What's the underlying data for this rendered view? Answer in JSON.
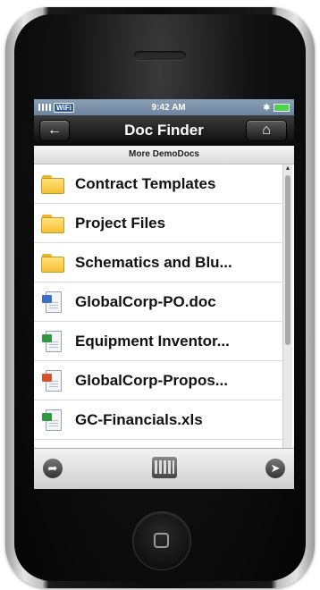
{
  "status_bar": {
    "time": "9:42 AM",
    "carrier_label": "WiFi",
    "bluetooth_glyph": "✱"
  },
  "nav": {
    "title": "Doc Finder",
    "back_icon": "back-arrow-icon",
    "home_icon": "home-icon"
  },
  "subheader": "More DemoDocs",
  "items": [
    {
      "label": "Contract Templates",
      "icon": "folder-icon",
      "type": "folder"
    },
    {
      "label": "Project Files",
      "icon": "folder-icon",
      "type": "folder"
    },
    {
      "label": "Schematics and Blu...",
      "icon": "folder-icon",
      "type": "folder"
    },
    {
      "label": "GlobalCorp-PO.doc",
      "icon": "word-doc-icon",
      "type": "doc",
      "badge_color": "#3b6fc9"
    },
    {
      "label": "Equipment Inventor...",
      "icon": "excel-doc-icon",
      "type": "doc",
      "badge_color": "#2f9a3d"
    },
    {
      "label": "GlobalCorp-Propos...",
      "icon": "powerpoint-doc-icon",
      "type": "doc",
      "badge_color": "#d8512a"
    },
    {
      "label": "GC-Financials.xls",
      "icon": "excel-doc-icon",
      "type": "doc",
      "badge_color": "#2f9a3d"
    }
  ],
  "toolbar": {
    "left_icon": "forward-arrow-icon",
    "center_icon": "keyboard-icon",
    "right_icon": "cursor-pointer-icon"
  }
}
